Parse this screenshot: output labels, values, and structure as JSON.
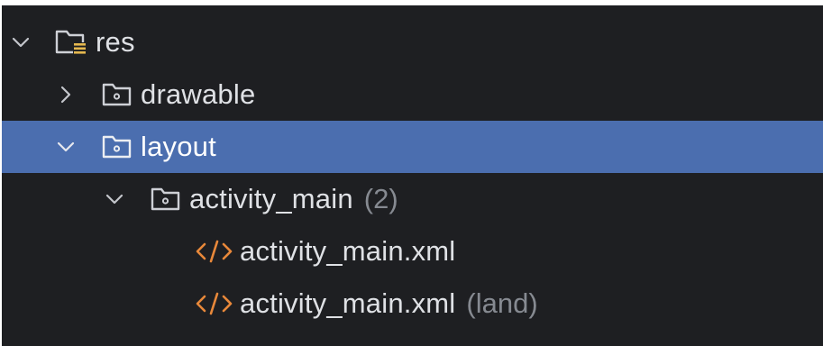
{
  "tree": {
    "rows": [
      {
        "label": "res",
        "hint": "",
        "expanded": true,
        "icon": "resource-folder-icon"
      },
      {
        "label": "drawable",
        "hint": "",
        "expanded": false,
        "icon": "folder-icon"
      },
      {
        "label": "layout",
        "hint": "",
        "expanded": true,
        "icon": "folder-icon",
        "selected": true
      },
      {
        "label": "activity_main",
        "hint": "(2)",
        "expanded": true,
        "icon": "folder-icon"
      },
      {
        "label": "activity_main.xml",
        "hint": "",
        "icon": "xml-code-icon"
      },
      {
        "label": "activity_main.xml",
        "hint": "(land)",
        "icon": "xml-code-icon"
      }
    ]
  },
  "colors": {
    "background": "#1e1f22",
    "selection": "#4b6eaf",
    "text": "#dfe1e5",
    "hint_text": "#868a91",
    "xml_icon": "#e8883a",
    "chevron": "#c4c6cc"
  }
}
